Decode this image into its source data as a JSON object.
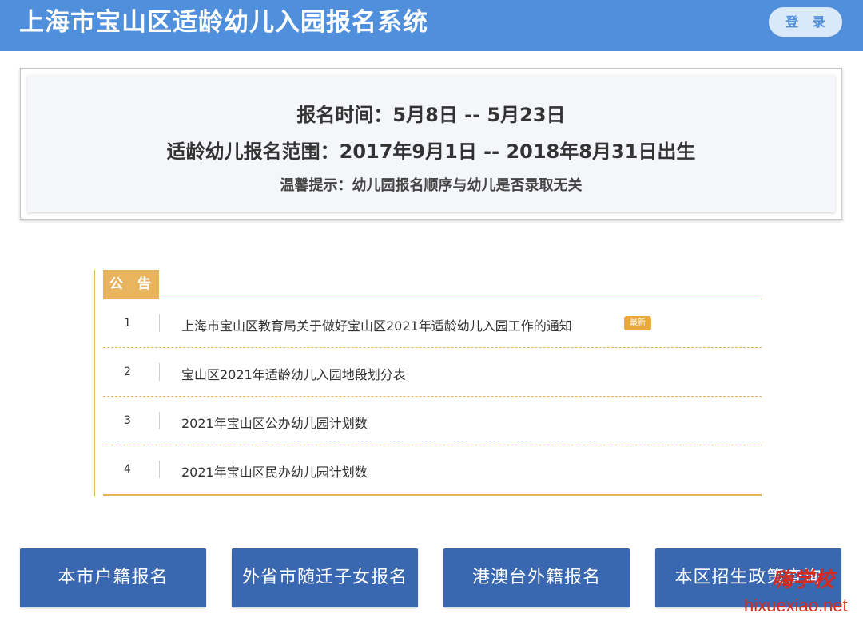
{
  "header": {
    "title": "上海市宝山区适龄幼儿入园报名系统",
    "login_label": "登 录",
    "colors": {
      "bar": "#4f8fdc",
      "login_bg": "#d9e9fa"
    }
  },
  "info": {
    "registration_period": "报名时间：5月8日 -- 5月23日",
    "eligible_range": "适龄幼儿报名范围：2017年9月1日 -- 2018年8月31日出生",
    "reminder": "温馨提示：幼儿园报名顺序与幼儿是否录取无关"
  },
  "notice": {
    "tab_label": "公 告",
    "accent_color": "#e9b45e",
    "items": [
      {
        "num": "1",
        "title": "上海市宝山区教育局关于做好宝山区2021年适龄幼儿入园工作的通知",
        "badge": "最新"
      },
      {
        "num": "2",
        "title": "宝山区2021年适龄幼儿入园地段划分表"
      },
      {
        "num": "3",
        "title": "2021年宝山区公办幼儿园计划数"
      },
      {
        "num": "4",
        "title": "2021年宝山区民办幼儿园计划数"
      }
    ]
  },
  "buttons": {
    "color": "#3a68b0",
    "local_registration": "本市户籍报名",
    "migrant_children": "外省市随迁子女报名",
    "hk_macau_tw_foreign": "港澳台外籍报名",
    "policy_query": "本区招生政策查询"
  },
  "watermark": {
    "stamp_text": "嗨学校",
    "url": "hixuexiao.net"
  }
}
